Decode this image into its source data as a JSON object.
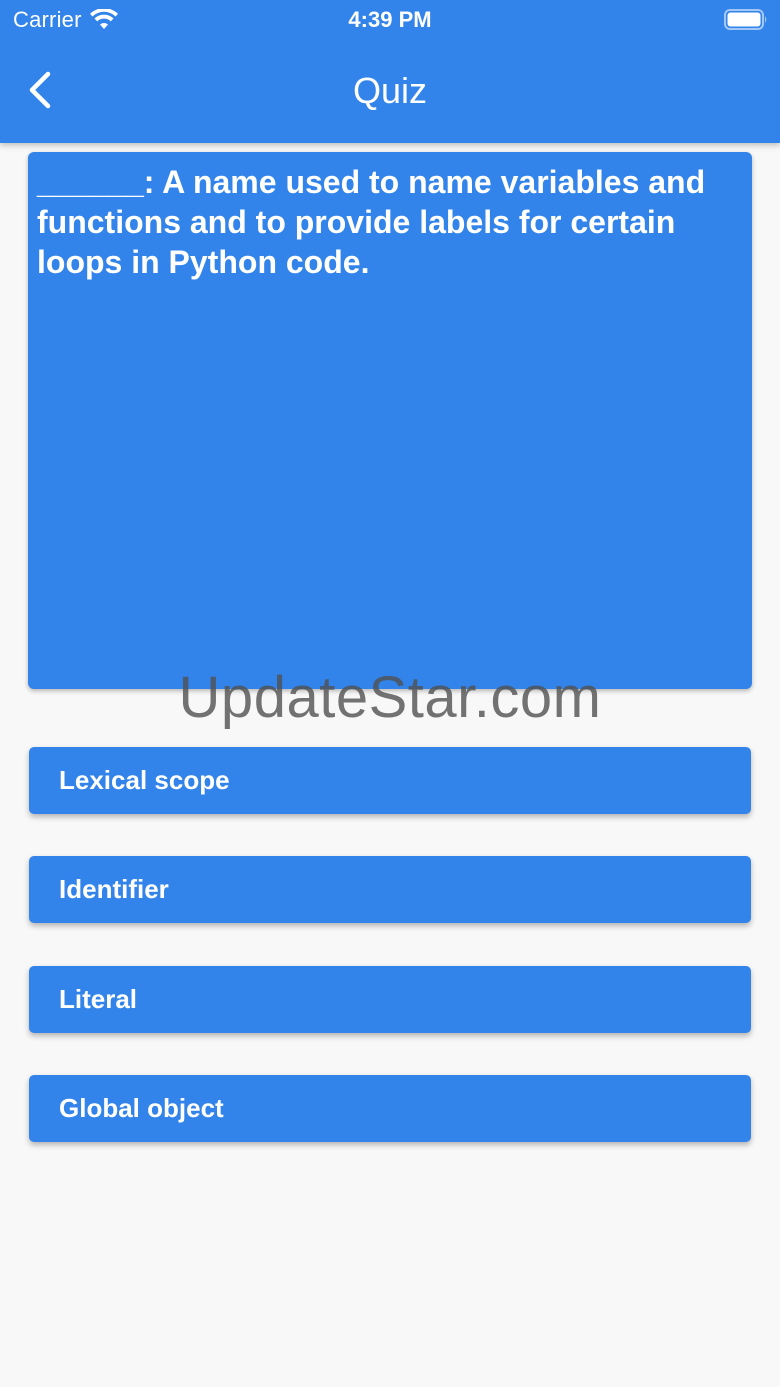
{
  "status_bar": {
    "carrier": "Carrier",
    "time": "4:39 PM"
  },
  "nav": {
    "title": "Quiz",
    "back_icon": "chevron-left-icon"
  },
  "question": {
    "text": "______: A name used to name variables and functions and to provide labels for certain loops in Python code."
  },
  "answers": [
    {
      "label": "Lexical scope"
    },
    {
      "label": "Identifier"
    },
    {
      "label": "Literal"
    },
    {
      "label": "Global object"
    }
  ],
  "watermark": "UpdateStar.com",
  "colors": {
    "primary": "#3284ea",
    "background": "#f8f8f8",
    "text_on_primary": "#ffffff"
  }
}
